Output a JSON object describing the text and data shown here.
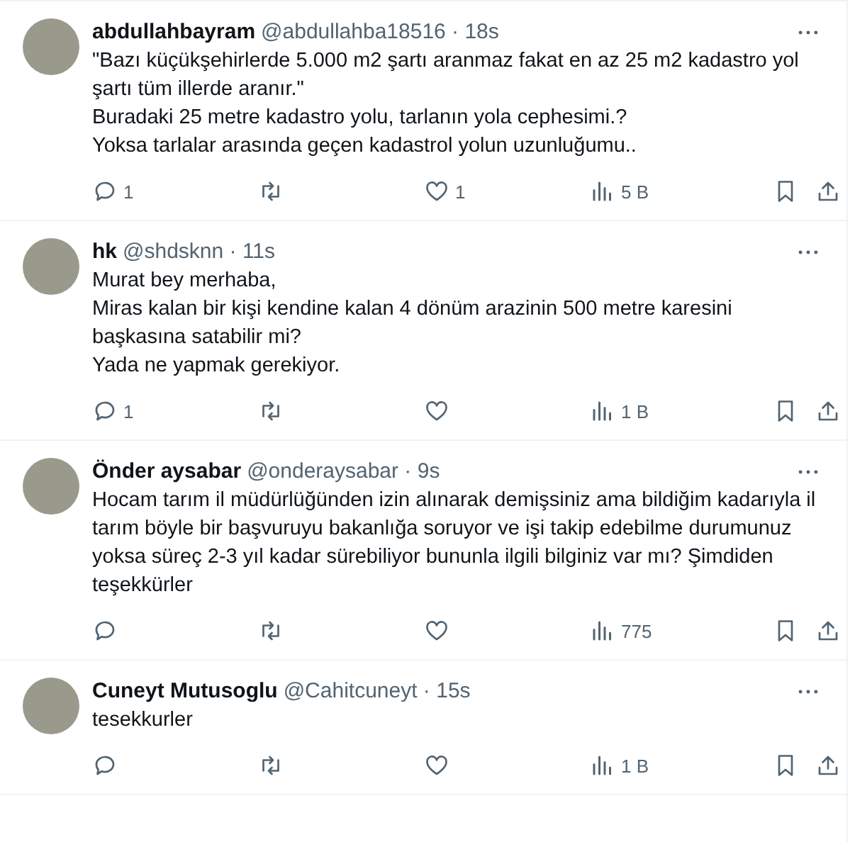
{
  "replies": [
    {
      "name": "abdullahbayram",
      "meta": "@abdullahba18516 · 18s",
      "text": "\"Bazı küçükşehirlerde 5.000 m2 şartı aranmaz fakat en az 25 m2 kadastro yol şartı tüm illerde aranır.\"\nBuradaki 25 metre kadastro yolu, tarlanın yola cephesimi.?\nYoksa tarlalar arasında geçen kadastrol yolun uzunluğumu..",
      "reply_count": "1",
      "like_count": "1",
      "views": "5 B"
    },
    {
      "name": "hk",
      "meta": "@shdsknn · 11s",
      "text": "Murat bey merhaba,\nMiras kalan bir kişi kendine kalan 4 dönüm arazinin 500 metre karesini başkasına satabilir mi?\nYada ne yapmak gerekiyor.",
      "reply_count": "1",
      "views": "1 B"
    },
    {
      "name": "Önder aysabar",
      "meta": "@onderaysabar · 9s",
      "text": "Hocam tarım il müdürlüğünden izin alınarak demişsiniz ama bildiğim kadarıyla il tarım böyle bir başvuruyu bakanlığa soruyor ve işi takip edebilme durumunuz yoksa süreç 2-3 yıl kadar sürebiliyor bununla ilgili bilginiz var mı? Şimdiden teşekkürler",
      "views": "775"
    },
    {
      "name": "Cuneyt Mutusoglu",
      "meta": "@Cahitcuneyt · 15s",
      "text": "tesekkurler",
      "views": "1 B"
    }
  ]
}
